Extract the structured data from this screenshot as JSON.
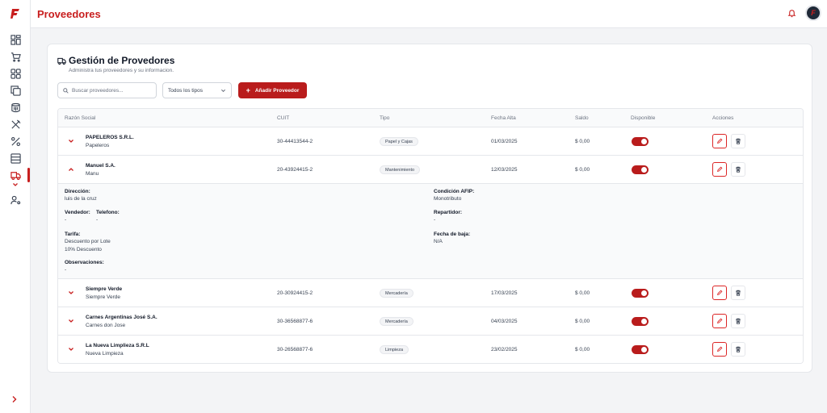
{
  "header": {
    "title": "Proveedores",
    "avatar_letter": "F"
  },
  "sidebar": {
    "items": [
      "dashboard-icon",
      "cart-icon",
      "grid-icon",
      "copy-icon",
      "cylinder-icon",
      "utensils-icon",
      "percent-icon",
      "list-icon",
      "truck-icon",
      "user-settings-icon"
    ],
    "active": "truck-icon"
  },
  "card": {
    "title": "Gestión de Provedores",
    "subtitle": "Administra tus proveedores y su informacion.",
    "search_placeholder": "Buscar proveedores...",
    "filter_selected": "Todos los tipos",
    "add_label": "Añadir Proveedor",
    "add_symbol": "+"
  },
  "table": {
    "columns": [
      "Razón Social",
      "CUIT",
      "Tipo",
      "Fecha Alta",
      "Saldo",
      "Disponible",
      "Acciones"
    ],
    "rows": [
      {
        "name": "PAPELEROS S.R.L.",
        "alias": "Papeleros",
        "cuit": "30-44413544-2",
        "tipo": "Papel y Cajas",
        "fecha": "01/03/2025",
        "saldo": "$ 0,00",
        "disponible": true,
        "expanded": false
      },
      {
        "name": "Manuel S.A.",
        "alias": "Manu",
        "cuit": "20-43924415-2",
        "tipo": "Mantenimiento",
        "fecha": "12/03/2025",
        "saldo": "$ 0,00",
        "disponible": true,
        "expanded": true
      },
      {
        "name": "Siempre Verde",
        "alias": "Siempre Verde",
        "cuit": "20-30924415-2",
        "tipo": "Mercadería",
        "fecha": "17/03/2025",
        "saldo": "$ 0,00",
        "disponible": true,
        "expanded": false
      },
      {
        "name": "Carnes Argentinas José S.A.",
        "alias": "Carnes don Jose",
        "cuit": "30-36568877-6",
        "tipo": "Mercadería",
        "fecha": "04/03/2025",
        "saldo": "$ 0,00",
        "disponible": true,
        "expanded": false
      },
      {
        "name": "La Nueva Limplieza S.R.L",
        "alias": "Nueva Limpieza",
        "cuit": "30-26568877-6",
        "tipo": "Limpieza",
        "fecha": "23/02/2025",
        "saldo": "$ 0,00",
        "disponible": true,
        "expanded": false
      }
    ]
  },
  "detail": {
    "direccion_label": "Dirección:",
    "direccion": "luis de la cruz",
    "vendedor_label": "Vendedor:",
    "vendedor": "-",
    "telefono_label": "Telefono:",
    "telefono": "-",
    "tarifa_label": "Tarifa:",
    "tarifa_1": "Descuento por Lote",
    "tarifa_2": "10% Descuento",
    "observaciones_label": "Observaciones:",
    "observaciones": "-",
    "condicion_label": "Condición AFIP:",
    "condicion": "Monotributo",
    "repartidor_label": "Repartidor:",
    "repartidor": "-",
    "baja_label": "Fecha de baja:",
    "baja": "N/A"
  },
  "colors": {
    "accent": "#c81e1e",
    "toggle": "#b91c1c"
  }
}
